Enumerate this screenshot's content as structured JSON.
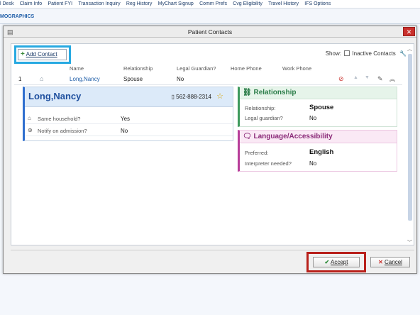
{
  "topnav": {
    "items": [
      "l Desk",
      "Claim Info",
      "Patient FYI",
      "Transaction Inquiry",
      "Reg History",
      "MyChart Signup",
      "Comm Prefs",
      "Cvg Eligibility",
      "Travel History",
      "IFS Options"
    ]
  },
  "background": {
    "section_title": "MOGRAPHICS"
  },
  "dialog": {
    "title": "Patient Contacts",
    "close_label": "✕",
    "add_contact_label": "Add Contact",
    "show_label": "Show:",
    "inactive_label": "Inactive Contacts",
    "columns": [
      "Name",
      "Relationship",
      "Legal Guardian?",
      "Home Phone",
      "Work Phone"
    ],
    "row": {
      "index": "1",
      "name": "Long,Nancy",
      "relationship": "Spouse",
      "legal_guardian": "No"
    },
    "contact_card": {
      "name": "Long,Nancy",
      "phone": "562-888-2314",
      "same_household_label": "Same household?",
      "same_household_value": "Yes",
      "notify_label": "Notify on admission?",
      "notify_value": "No"
    },
    "relationship_card": {
      "title": "Relationship",
      "relationship_label": "Relationship:",
      "relationship_value": "Spouse",
      "guardian_label": "Legal guardian?",
      "guardian_value": "No"
    },
    "language_card": {
      "title": "Language/Accessibility",
      "preferred_label": "Preferred:",
      "preferred_value": "English",
      "interpreter_label": "Interpreter needed?",
      "interpreter_value": "No"
    },
    "accept_label": "Accept",
    "cancel_label": "Cancel"
  },
  "colors": {
    "highlight_add": "#27a9e1",
    "highlight_accept": "#b8201b",
    "relationship_accent": "#3e9a5d",
    "language_accent": "#b83e9a",
    "contact_accent": "#2f6fcf"
  }
}
